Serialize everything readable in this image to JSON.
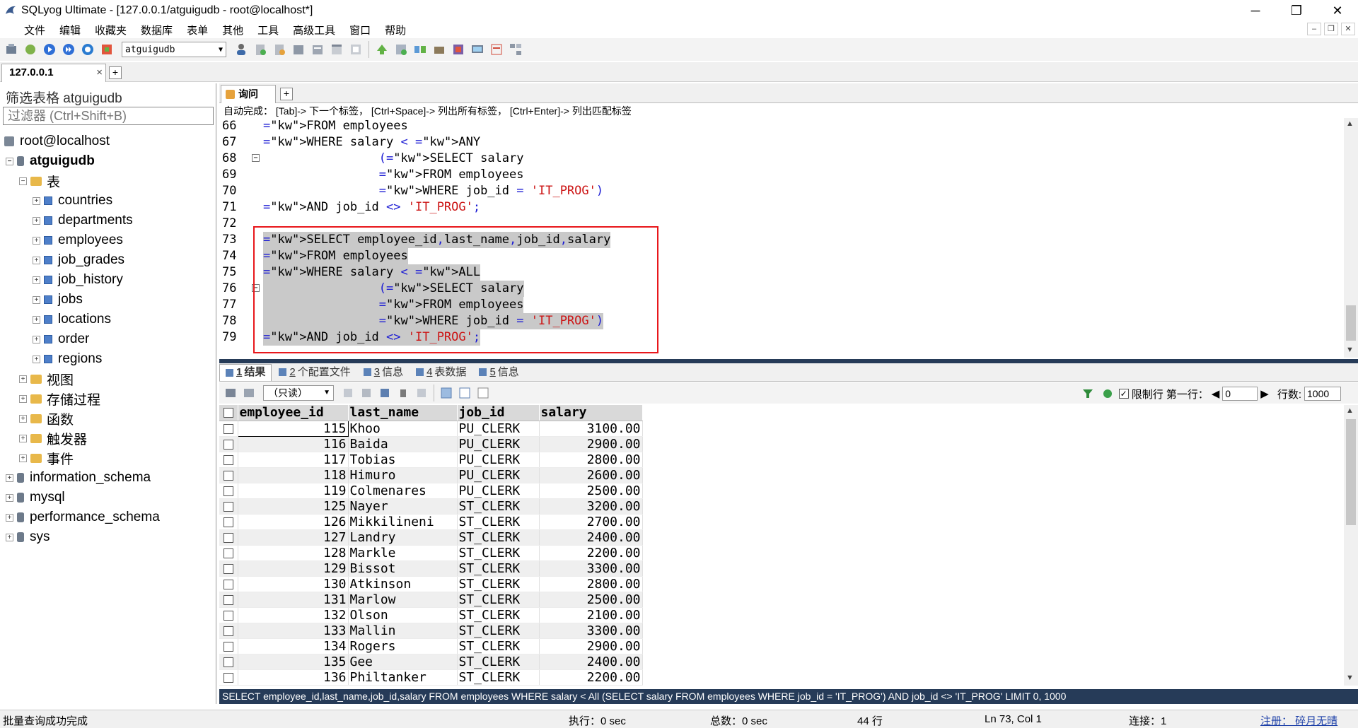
{
  "window": {
    "title": "SQLyog Ultimate - [127.0.0.1/atguigudb - root@localhost*]",
    "controls": [
      "─",
      "❐",
      "✕"
    ]
  },
  "menu": [
    "文件",
    "编辑",
    "收藏夹",
    "数据库",
    "表单",
    "其他",
    "工具",
    "高级工具",
    "窗口",
    "帮助"
  ],
  "toolbar": {
    "db_select": "atguigudb"
  },
  "connection_tab": {
    "label": "127.0.0.1",
    "close": "×",
    "add": "+"
  },
  "left": {
    "filter_label": "筛选表格 atguigudb",
    "filter_placeholder": "过滤器 (Ctrl+Shift+B)",
    "server": "root@localhost",
    "db": "atguigudb",
    "tables_folder": "表",
    "tables": [
      "countries",
      "departments",
      "employees",
      "job_grades",
      "job_history",
      "jobs",
      "locations",
      "order",
      "regions"
    ],
    "folders": [
      "视图",
      "存储过程",
      "函数",
      "触发器",
      "事件"
    ],
    "other_dbs": [
      "information_schema",
      "mysql",
      "performance_schema",
      "sys"
    ]
  },
  "editor": {
    "tab_label": "询问",
    "add": "+",
    "autocomplete": "自动完成：  [Tab]-> 下一个标签，  [Ctrl+Space]-> 列出所有标签，  [Ctrl+Enter]-> 列出匹配标签",
    "lines": [
      {
        "n": "66",
        "t": "FROM employees"
      },
      {
        "n": "67",
        "t": "WHERE salary < ANY"
      },
      {
        "n": "68",
        "t": "                (SELECT salary"
      },
      {
        "n": "69",
        "t": "                FROM employees"
      },
      {
        "n": "70",
        "t": "                WHERE job_id = 'IT_PROG')"
      },
      {
        "n": "71",
        "t": "AND job_id <> 'IT_PROG';"
      },
      {
        "n": "72",
        "t": ""
      },
      {
        "n": "73",
        "t": "SELECT employee_id,last_name,job_id,salary"
      },
      {
        "n": "74",
        "t": "FROM employees"
      },
      {
        "n": "75",
        "t": "WHERE salary < ALL"
      },
      {
        "n": "76",
        "t": "                (SELECT salary"
      },
      {
        "n": "77",
        "t": "                FROM employees"
      },
      {
        "n": "78",
        "t": "                WHERE job_id = 'IT_PROG')"
      },
      {
        "n": "79",
        "t": "AND job_id <> 'IT_PROG';"
      }
    ]
  },
  "result_tabs": [
    {
      "num": "1",
      "label": "结果"
    },
    {
      "num": "2",
      "label": "个配置文件"
    },
    {
      "num": "3",
      "label": "信息"
    },
    {
      "num": "4",
      "label": "表数据"
    },
    {
      "num": "5",
      "label": "信息"
    }
  ],
  "result_toolbar": {
    "readonly": "（只读）",
    "limit_label": "限制行",
    "first_row_label": "第一行：",
    "first_row_value": "0",
    "rows_label": "行数:",
    "rows_value": "1000"
  },
  "grid": {
    "columns": [
      "employee_id",
      "last_name",
      "job_id",
      "salary"
    ],
    "rows": [
      [
        "115",
        "Khoo",
        "PU_CLERK",
        "3100.00"
      ],
      [
        "116",
        "Baida",
        "PU_CLERK",
        "2900.00"
      ],
      [
        "117",
        "Tobias",
        "PU_CLERK",
        "2800.00"
      ],
      [
        "118",
        "Himuro",
        "PU_CLERK",
        "2600.00"
      ],
      [
        "119",
        "Colmenares",
        "PU_CLERK",
        "2500.00"
      ],
      [
        "125",
        "Nayer",
        "ST_CLERK",
        "3200.00"
      ],
      [
        "126",
        "Mikkilineni",
        "ST_CLERK",
        "2700.00"
      ],
      [
        "127",
        "Landry",
        "ST_CLERK",
        "2400.00"
      ],
      [
        "128",
        "Markle",
        "ST_CLERK",
        "2200.00"
      ],
      [
        "129",
        "Bissot",
        "ST_CLERK",
        "3300.00"
      ],
      [
        "130",
        "Atkinson",
        "ST_CLERK",
        "2800.00"
      ],
      [
        "131",
        "Marlow",
        "ST_CLERK",
        "2500.00"
      ],
      [
        "132",
        "Olson",
        "ST_CLERK",
        "2100.00"
      ],
      [
        "133",
        "Mallin",
        "ST_CLERK",
        "3300.00"
      ],
      [
        "134",
        "Rogers",
        "ST_CLERK",
        "2900.00"
      ],
      [
        "135",
        "Gee",
        "ST_CLERK",
        "2400.00"
      ],
      [
        "136",
        "Philtanker",
        "ST_CLERK",
        "2200.00"
      ]
    ]
  },
  "sql_bar": "SELECT employee_id,last_name,job_id,salary FROM employees WHERE salary < All (SELECT salary FROM employees WHERE job_id = 'IT_PROG') AND job_id <> 'IT_PROG' LIMIT 0, 1000",
  "status": {
    "message": "批量查询成功完成",
    "exec": "执行：0 sec",
    "total": "总数：0 sec",
    "rows": "44 行",
    "position": "Ln 73, Col 1",
    "connections": "连接：1",
    "register": "注册：  碎月无晴"
  }
}
